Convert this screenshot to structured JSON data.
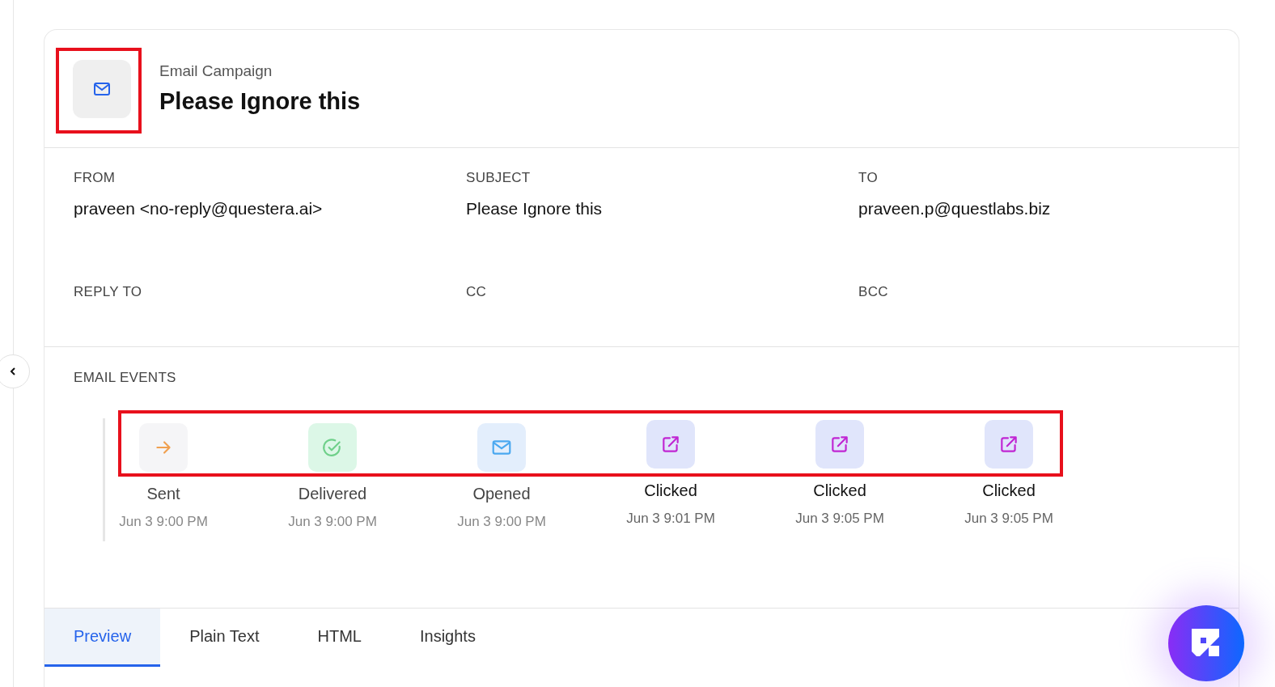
{
  "header": {
    "eyebrow": "Email Campaign",
    "title": "Please Ignore this",
    "icon_highlighted": true
  },
  "fields": [
    {
      "label": "FROM",
      "value": "praveen <no-reply@questera.ai>"
    },
    {
      "label": "SUBJECT",
      "value": "Please Ignore this"
    },
    {
      "label": "TO",
      "value": "praveen.p@questlabs.biz"
    },
    {
      "label": "REPLY TO"
    },
    {
      "label": "CC"
    },
    {
      "label": "BCC"
    }
  ],
  "events_section": {
    "label": "EMAIL EVENTS",
    "icons_highlighted": true,
    "events": [
      {
        "kind": "sent",
        "label": "Sent",
        "time": "Jun 3 9:00 PM"
      },
      {
        "kind": "delivered",
        "label": "Delivered",
        "time": "Jun 3 9:00 PM"
      },
      {
        "kind": "opened",
        "label": "Opened",
        "time": "Jun 3 9:00 PM"
      },
      {
        "kind": "clicked",
        "label": "Clicked",
        "time": "Jun 3 9:01 PM"
      },
      {
        "kind": "clicked",
        "label": "Clicked",
        "time": "Jun 3 9:05 PM"
      },
      {
        "kind": "clicked",
        "label": "Clicked",
        "time": "Jun 3 9:05 PM"
      }
    ]
  },
  "tabs": [
    {
      "label": "Preview",
      "selected": true
    },
    {
      "label": "Plain Text",
      "selected": false
    },
    {
      "label": "HTML",
      "selected": false
    },
    {
      "label": "Insights",
      "selected": false
    }
  ]
}
